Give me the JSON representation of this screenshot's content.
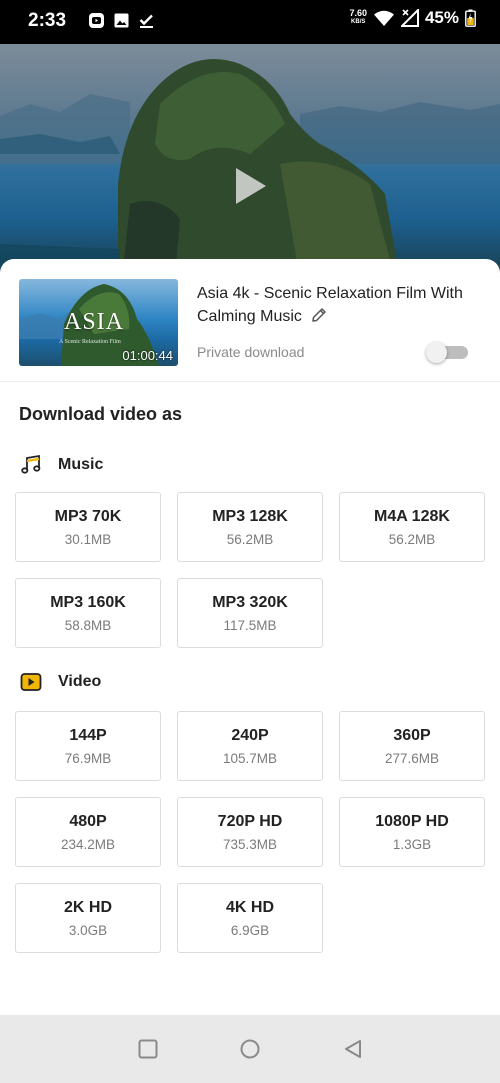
{
  "status_bar": {
    "time": "2:33",
    "net_speed_value": "7.60",
    "net_speed_unit": "KB/S",
    "battery": "45%"
  },
  "video": {
    "title": "Asia 4k - Scenic Relaxation Film With Calming Music",
    "thumbnail_title": "ASIA",
    "thumbnail_subtitle": "A Scenic Relaxation Film",
    "duration": "01:00:44",
    "private_download_label": "Private download",
    "private_download_enabled": false
  },
  "download": {
    "heading": "Download video as",
    "music": {
      "label": "Music",
      "icon": "music-note-icon",
      "options": [
        {
          "format": "MP3 70K",
          "size": "30.1MB"
        },
        {
          "format": "MP3 128K",
          "size": "56.2MB"
        },
        {
          "format": "M4A 128K",
          "size": "56.2MB"
        },
        {
          "format": "MP3 160K",
          "size": "58.8MB"
        },
        {
          "format": "MP3 320K",
          "size": "117.5MB"
        }
      ]
    },
    "video": {
      "label": "Video",
      "icon": "video-play-icon",
      "options": [
        {
          "format": "144P",
          "size": "76.9MB"
        },
        {
          "format": "240P",
          "size": "105.7MB"
        },
        {
          "format": "360P",
          "size": "277.6MB"
        },
        {
          "format": "480P",
          "size": "234.2MB"
        },
        {
          "format": "720P HD",
          "size": "735.3MB"
        },
        {
          "format": "1080P HD",
          "size": "1.3GB"
        },
        {
          "format": "2K HD",
          "size": "3.0GB"
        },
        {
          "format": "4K HD",
          "size": "6.9GB"
        }
      ]
    }
  },
  "colors": {
    "accent": "#f2b705",
    "text_primary": "#222222",
    "text_secondary": "#7b7b7b"
  }
}
